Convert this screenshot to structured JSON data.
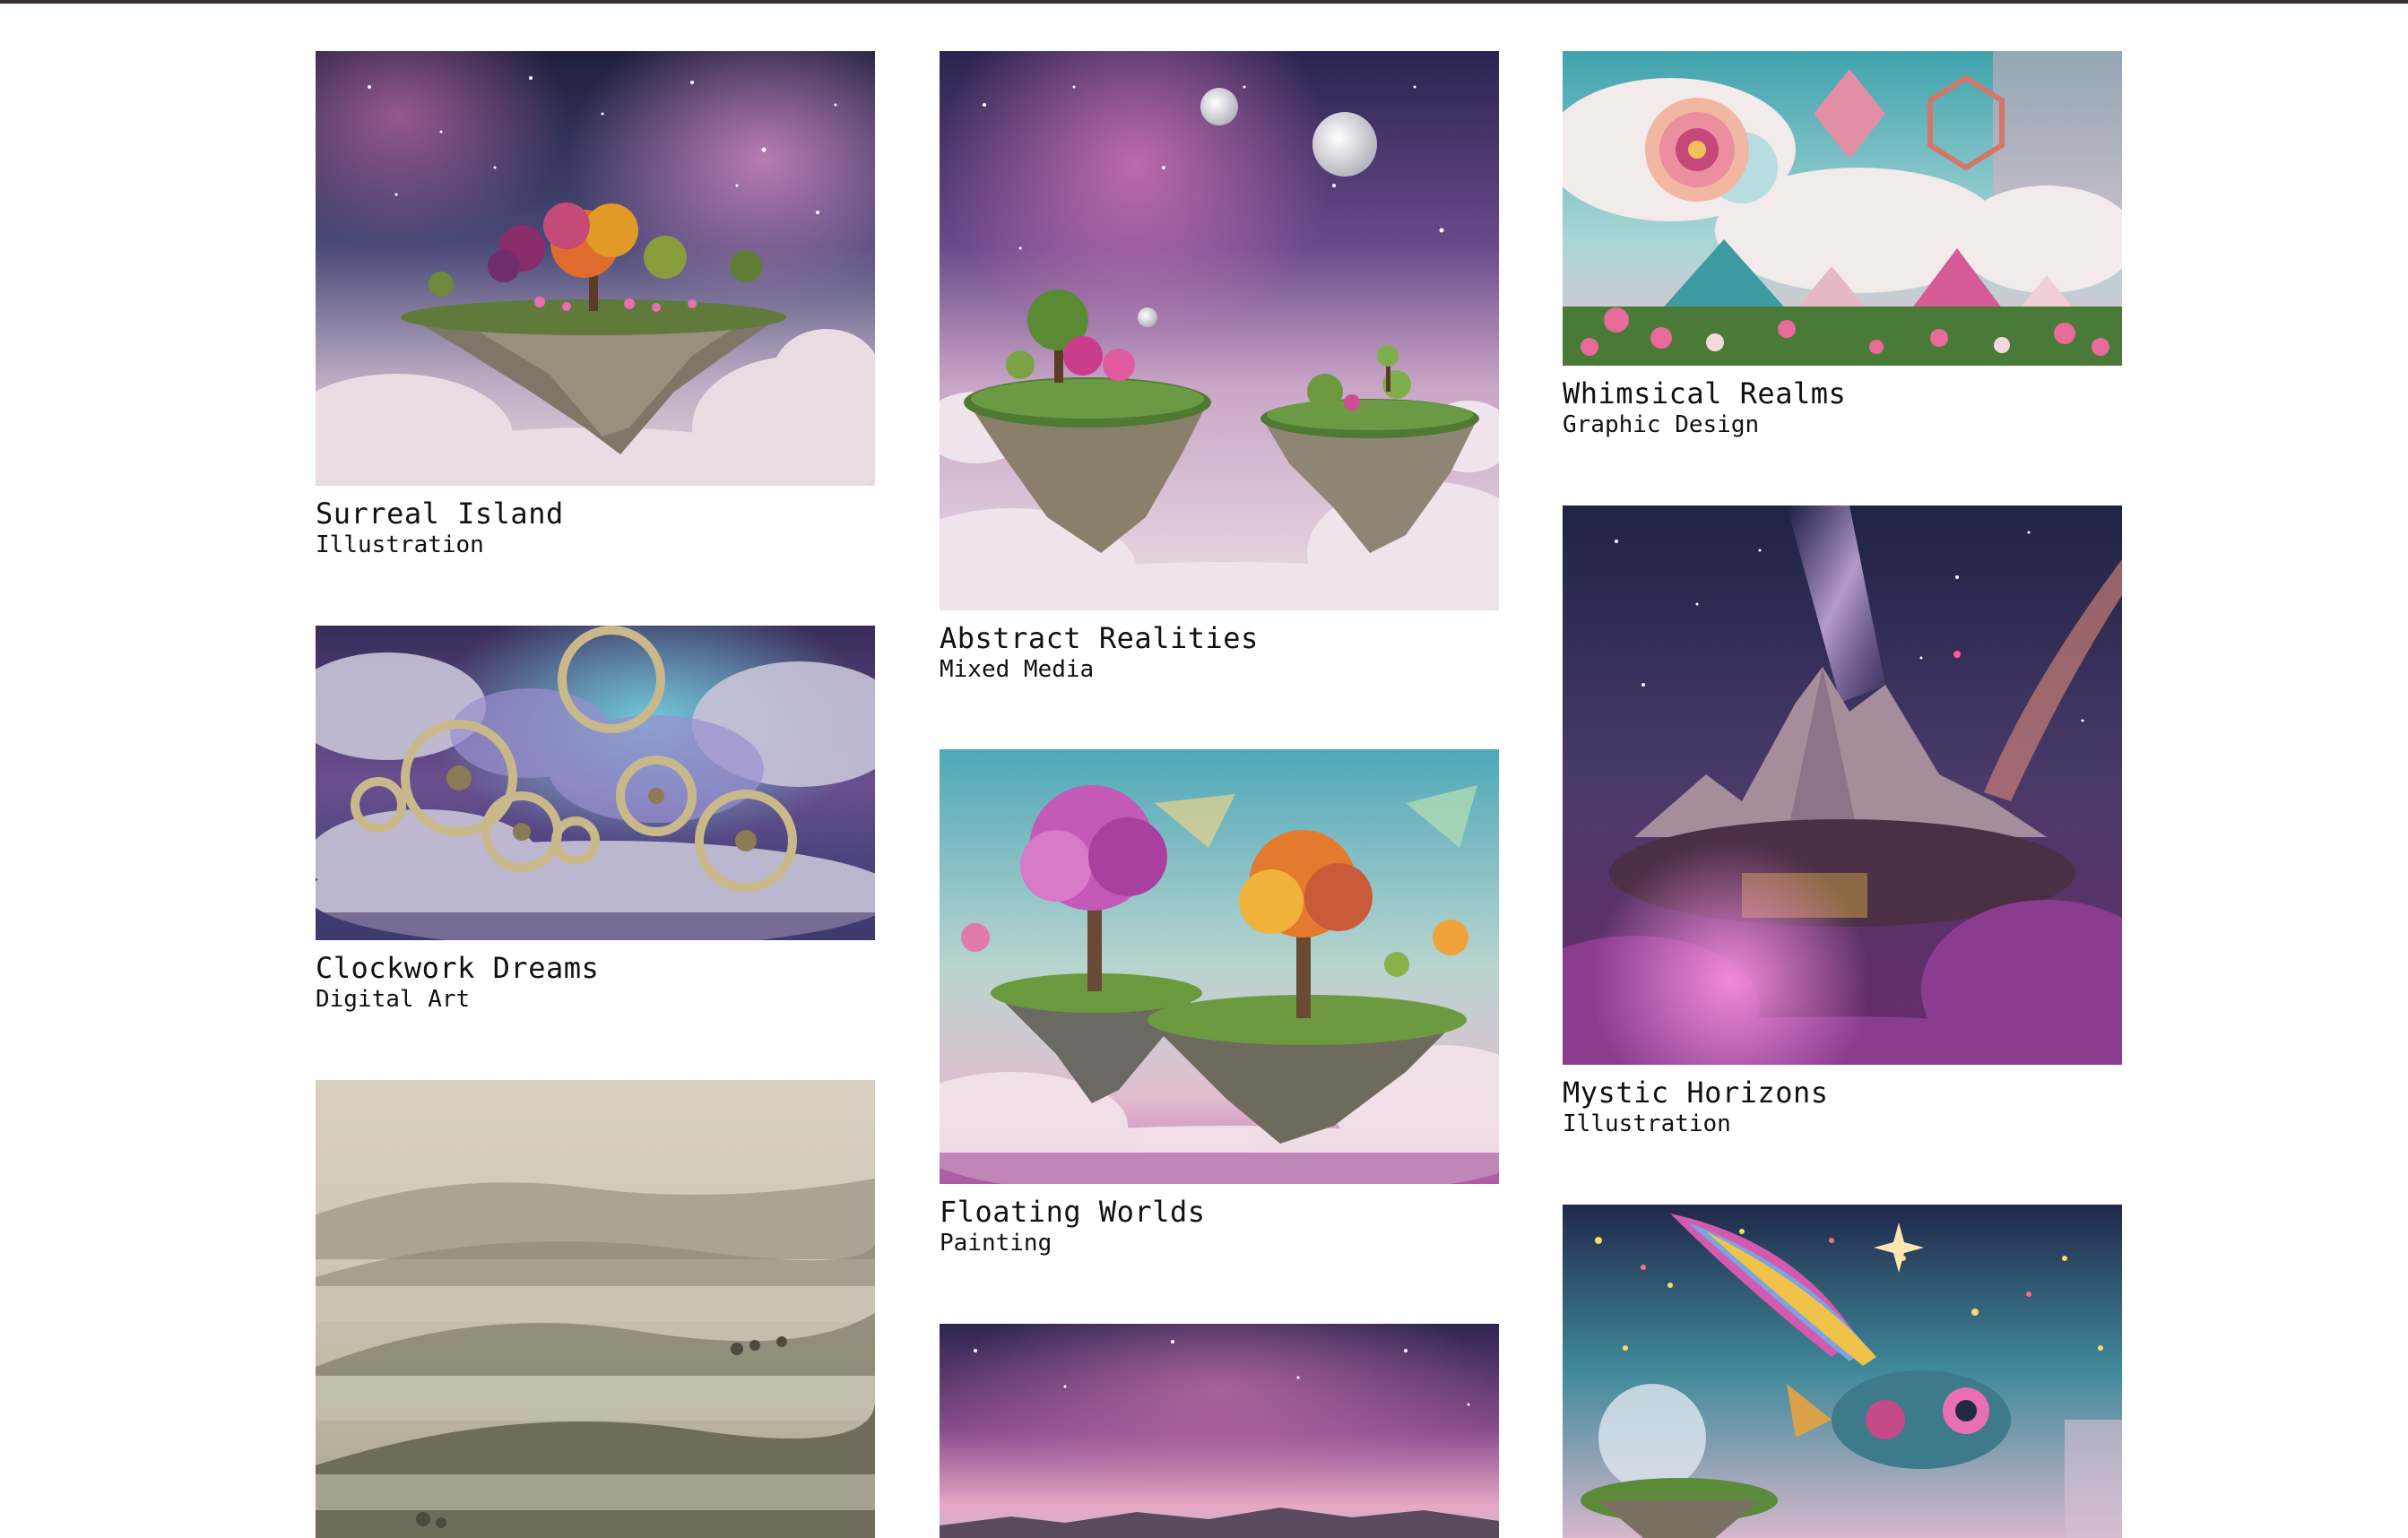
{
  "gallery": {
    "items": [
      {
        "title": "Surreal Island",
        "category": "Illustration",
        "image": "floating island with flowering trees above clouds under a starry galaxy sky"
      },
      {
        "title": "Clockwork Dreams",
        "category": "Digital Art",
        "image": "brass clock gears floating among purple and blue clouds"
      },
      {
        "title": "Abstract Realities",
        "category": "Mixed Media",
        "image": "two floating grassy islands with trees, two moons and galaxy sky"
      },
      {
        "title": "Floating Worlds",
        "category": "Painting",
        "image": "floating islands with pink and orange trees in a pastel sky"
      },
      {
        "title": "Whimsical Realms",
        "category": "Graphic Design",
        "image": "paper flower with geometric crystals and clouds over a flower field"
      },
      {
        "title": "Mystic Horizons",
        "category": "Illustration",
        "image": "jagged mountains under the milky way with pink cosmic clouds"
      }
    ],
    "partial_items": [
      {
        "image": "misty rolling hills at dawn"
      },
      {
        "image": "galaxy sky over a hazy horizon"
      },
      {
        "image": "rainbow winged fish flying over a floating island under stars"
      }
    ]
  },
  "colors": {
    "top_border": "#3a2f33",
    "text": "#111111",
    "background": "#ffffff"
  }
}
